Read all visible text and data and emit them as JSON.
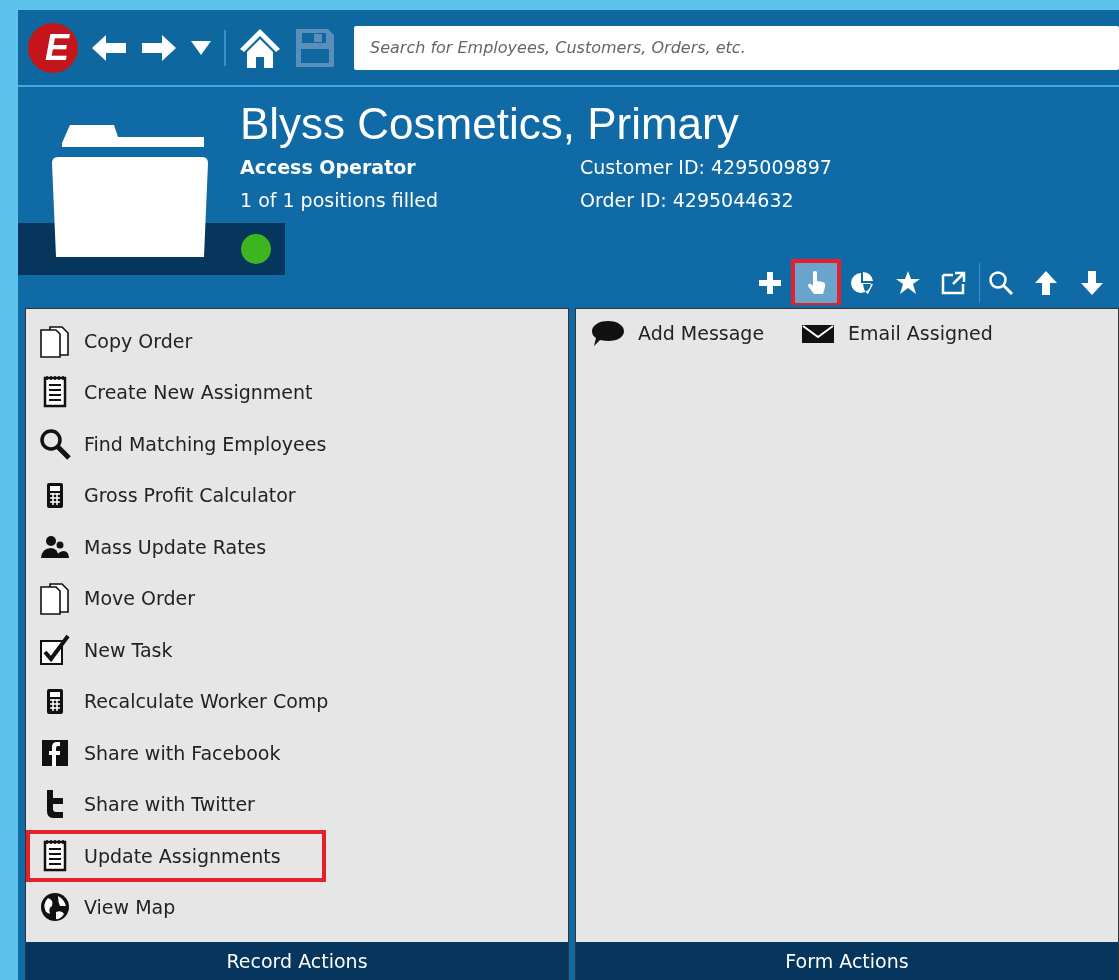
{
  "toolbar": {
    "logo": "E",
    "search": {
      "placeholder": "Search for Employees, Customers, Orders, etc."
    }
  },
  "record": {
    "title": "Blyss Cosmetics, Primary",
    "position": "Access Operator",
    "filled": "1 of 1 positions filled",
    "customer_id": "Customer ID: 4295009897",
    "order_id": "Order ID: 4295044632",
    "online": true
  },
  "action_buttons": [
    {
      "highlighted": false
    },
    {
      "highlighted": true
    },
    {
      "highlighted": false
    },
    {
      "highlighted": false
    },
    {
      "highlighted": false
    },
    {
      "highlighted": false
    },
    {
      "highlighted": false
    },
    {
      "highlighted": false
    }
  ],
  "record_actions": {
    "items": [
      {
        "label": "Copy Order",
        "highlighted": false
      },
      {
        "label": "Create New Assignment",
        "highlighted": false
      },
      {
        "label": "Find Matching Employees",
        "highlighted": false
      },
      {
        "label": "Gross Profit Calculator",
        "highlighted": false
      },
      {
        "label": "Mass Update Rates",
        "highlighted": false
      },
      {
        "label": "Move Order",
        "highlighted": false
      },
      {
        "label": "New Task",
        "highlighted": false
      },
      {
        "label": "Recalculate Worker Comp",
        "highlighted": false
      },
      {
        "label": "Share with Facebook",
        "highlighted": false
      },
      {
        "label": "Share with Twitter",
        "highlighted": false
      },
      {
        "label": "Update Assignments",
        "highlighted": true
      },
      {
        "label": "View Map",
        "highlighted": false
      }
    ],
    "footer": "Record Actions"
  },
  "form_actions": {
    "items": [
      {
        "label": "Add Message"
      },
      {
        "label": "Email Assigned"
      }
    ],
    "footer": "Form Actions"
  }
}
